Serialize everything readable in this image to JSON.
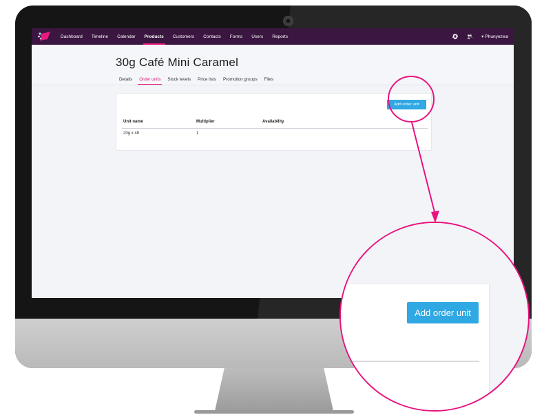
{
  "app": {
    "nav": {
      "items": [
        {
          "label": "Dashboard",
          "active": false
        },
        {
          "label": "Timeline",
          "active": false
        },
        {
          "label": "Calendar",
          "active": false
        },
        {
          "label": "Products",
          "active": true
        },
        {
          "label": "Customers",
          "active": false
        },
        {
          "label": "Contacts",
          "active": false
        },
        {
          "label": "Forms",
          "active": false
        },
        {
          "label": "Users",
          "active": false
        },
        {
          "label": "Reports",
          "active": false
        }
      ],
      "user": "Phunyezwa",
      "icons": [
        "gear-icon",
        "users-icon",
        "caret-down-icon"
      ]
    },
    "page": {
      "title": "30g Café Mini Caramel",
      "tabs": [
        {
          "label": "Details",
          "active": false
        },
        {
          "label": "Order units",
          "active": true
        },
        {
          "label": "Stock levels",
          "active": false
        },
        {
          "label": "Price lists",
          "active": false
        },
        {
          "label": "Promotion groups",
          "active": false
        },
        {
          "label": "Files",
          "active": false
        }
      ]
    },
    "order_units": {
      "add_button": "Add order unit",
      "columns": [
        "Unit name",
        "Multiplier",
        "Availability"
      ],
      "rows": [
        {
          "unit_name": "20g x 48",
          "multiplier": "1",
          "availability": ""
        }
      ]
    },
    "zoom": {
      "add_button": "Add order unit"
    }
  },
  "colors": {
    "nav_bg": "#3a1640",
    "accent_pink": "#e8187e",
    "button_blue": "#2fa8e4",
    "callout": "#e8137f"
  }
}
